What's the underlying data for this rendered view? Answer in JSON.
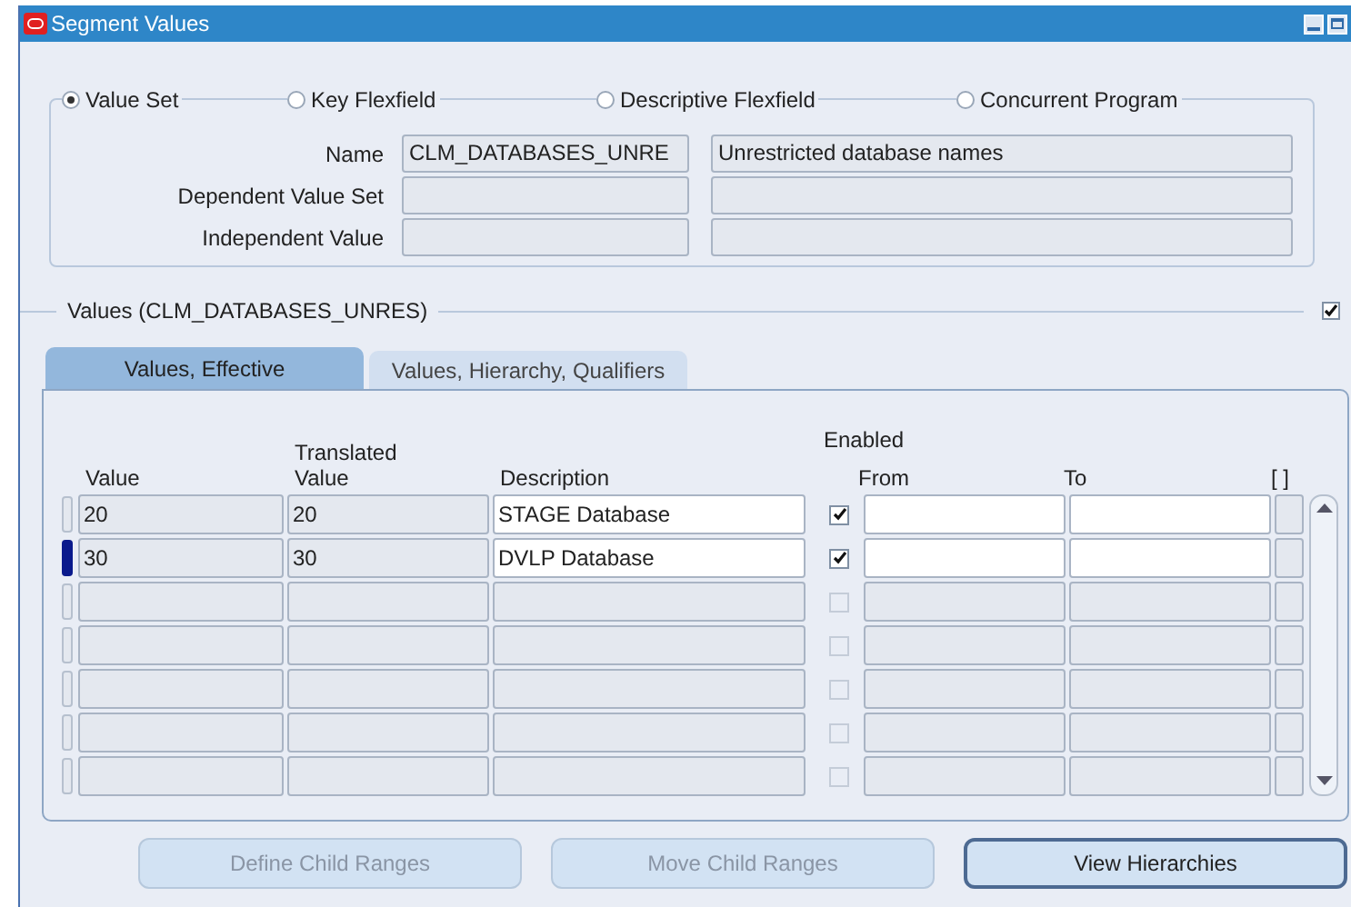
{
  "window": {
    "title": "Segment Values"
  },
  "source_options": [
    {
      "label": "Value Set",
      "selected": true
    },
    {
      "label": "Key Flexfield",
      "selected": false
    },
    {
      "label": "Descriptive Flexfield",
      "selected": false
    },
    {
      "label": "Concurrent Program",
      "selected": false
    }
  ],
  "fields": [
    {
      "label": "Name",
      "value": "CLM_DATABASES_UNRE",
      "description": "Unrestricted database names"
    },
    {
      "label": "Dependent Value Set"
    },
    {
      "label": "Independent Value"
    }
  ],
  "values_section": {
    "title": "Values (CLM_DATABASES_UNRES)",
    "checked": true
  },
  "tabs": [
    {
      "label": "Values, Effective",
      "selected": true
    },
    {
      "label": "Values, Hierarchy, Qualifiers",
      "selected": false
    }
  ],
  "table": {
    "columns": {
      "value": "Value",
      "translated_top": "Translated",
      "translated": "Value",
      "description": "Description",
      "enabled": "Enabled",
      "from": "From",
      "to": "To",
      "extra": "[ ]"
    },
    "rows": [
      {
        "kind": "record",
        "current": false,
        "value": "20",
        "translated": "20",
        "description": "STAGE Database",
        "enabled": true,
        "enabled_disabled": false
      },
      {
        "kind": "record",
        "current": true,
        "value": "30",
        "translated": "30",
        "description": "DVLP Database",
        "enabled": true,
        "enabled_disabled": false
      },
      {
        "kind": "empty",
        "current": false,
        "enabled": false,
        "enabled_disabled": true
      },
      {
        "kind": "empty",
        "current": false,
        "enabled": false,
        "enabled_disabled": true
      },
      {
        "kind": "empty",
        "current": false,
        "enabled": false,
        "enabled_disabled": true
      },
      {
        "kind": "empty",
        "current": false,
        "enabled": false,
        "enabled_disabled": true
      },
      {
        "kind": "empty",
        "current": false,
        "enabled": false,
        "enabled_disabled": true
      }
    ]
  },
  "buttons": [
    {
      "label": "Define Child Ranges",
      "disabled": true
    },
    {
      "label": "Move Child Ranges",
      "disabled": true
    },
    {
      "label": "View Hierarchies",
      "disabled": false
    }
  ]
}
